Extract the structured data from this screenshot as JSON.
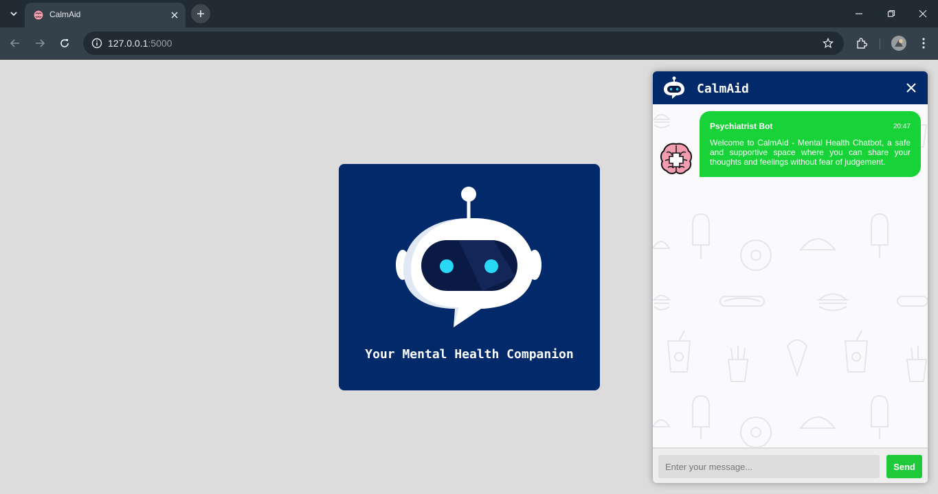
{
  "browser": {
    "tab": {
      "title": "CalmAid",
      "favicon": "brain-icon"
    },
    "url_host": "127.0.0.1",
    "url_port": ":5000",
    "icons": [
      "tab-search-icon",
      "close-icon",
      "plus-icon",
      "back-icon",
      "forward-icon",
      "reload-icon",
      "info-icon",
      "star-icon",
      "extensions-icon",
      "profile-avatar",
      "kebab-menu-icon",
      "minimize-icon",
      "restore-icon",
      "window-close-icon"
    ]
  },
  "hero": {
    "title": "Your Mental Health Companion",
    "icon": "robot-icon"
  },
  "chat": {
    "title": "CalmAid",
    "message": {
      "sender": "Psychiatrist Bot",
      "time": "20:47",
      "text": "Welcome to CalmAid - Mental Health Chatbot, a safe and supportive space where you can share your thoughts and feelings without fear of judgement."
    },
    "input_placeholder": "Enter your message...",
    "input_value": "",
    "send_label": "Send"
  },
  "colors": {
    "navy": "#022a6b",
    "bubble_green": "#17d338",
    "send_green": "#1fc93a",
    "page_bg": "#dcdcdc"
  }
}
